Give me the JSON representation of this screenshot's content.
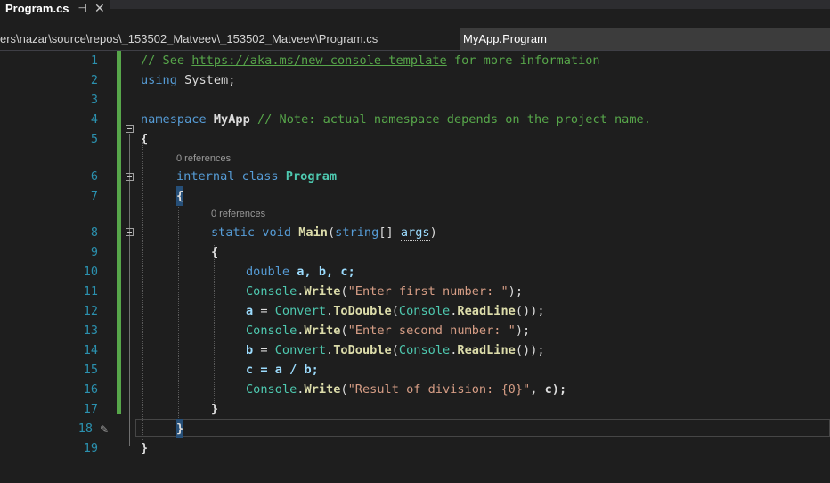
{
  "tab": {
    "title": "Program.cs",
    "pin_glyph": "⊣",
    "close_glyph": "✕"
  },
  "navbar": {
    "path": "ers\\nazar\\source\\repos\\_153502_Matveev\\_153502_Matveev\\Program.cs",
    "member": "MyApp.Program"
  },
  "codelens": {
    "class_refs": "0 references",
    "method_refs": "0 references"
  },
  "lines": {
    "l1": {
      "num": "1"
    },
    "l2": {
      "num": "2"
    },
    "l3": {
      "num": "3"
    },
    "l4": {
      "num": "4"
    },
    "l5": {
      "num": "5"
    },
    "l6": {
      "num": "6"
    },
    "l7": {
      "num": "7"
    },
    "l8": {
      "num": "8"
    },
    "l9": {
      "num": "9"
    },
    "l10": {
      "num": "10"
    },
    "l11": {
      "num": "11"
    },
    "l12": {
      "num": "12"
    },
    "l13": {
      "num": "13"
    },
    "l14": {
      "num": "14"
    },
    "l15": {
      "num": "15"
    },
    "l16": {
      "num": "16"
    },
    "l17": {
      "num": "17"
    },
    "l18": {
      "num": "18"
    },
    "l19": {
      "num": "19"
    }
  },
  "code": {
    "l1_comment_pre": "// See ",
    "l1_link": "https://aka.ms/new-console-template",
    "l1_comment_post": " for more information",
    "l2_kw": "using",
    "l2_rest": " System;",
    "l4_kw": "namespace",
    "l4_name": " MyApp ",
    "l4_comment": "// Note: actual namespace depends on the project name.",
    "brace_open": "{",
    "brace_close": "}",
    "l6_kw1": "internal",
    "l6_kw2": " class ",
    "l6_type": "Program",
    "l8_kw1": "static",
    "l8_kw2": " void ",
    "l8_meth": "Main",
    "l8_paren1": "(",
    "l8_kw3": "string",
    "l8_arr": "[] ",
    "l8_param": "args",
    "l8_paren2": ")",
    "l10_kw": "double",
    "l10_rest": " a, b, c;",
    "console": "Console",
    "dot": ".",
    "write": "Write",
    "paren_open": "(",
    "paren_close": ")",
    "semi": ";",
    "l11_str": "\"Enter first number: \"",
    "l12_a": "a",
    "assign": " = ",
    "convert": "Convert",
    "todouble": "ToDouble",
    "readline": "ReadLine",
    "l12_tail": "());",
    "l13_str": "\"Enter second number: \"",
    "l14_b": "b",
    "l15_text": "c = a / b;",
    "l16_str": "\"Result of division: {0}\"",
    "l16_tail": ", c);"
  },
  "icons": {
    "pencil": "✎"
  },
  "colors": {
    "background": "#1e1e1e",
    "line_number": "#2b91af",
    "keyword": "#569cd6",
    "type": "#4ec9b0",
    "method": "#dcdcaa",
    "string": "#d69d85",
    "comment": "#57a64a",
    "change_bar": "#57a64a"
  }
}
